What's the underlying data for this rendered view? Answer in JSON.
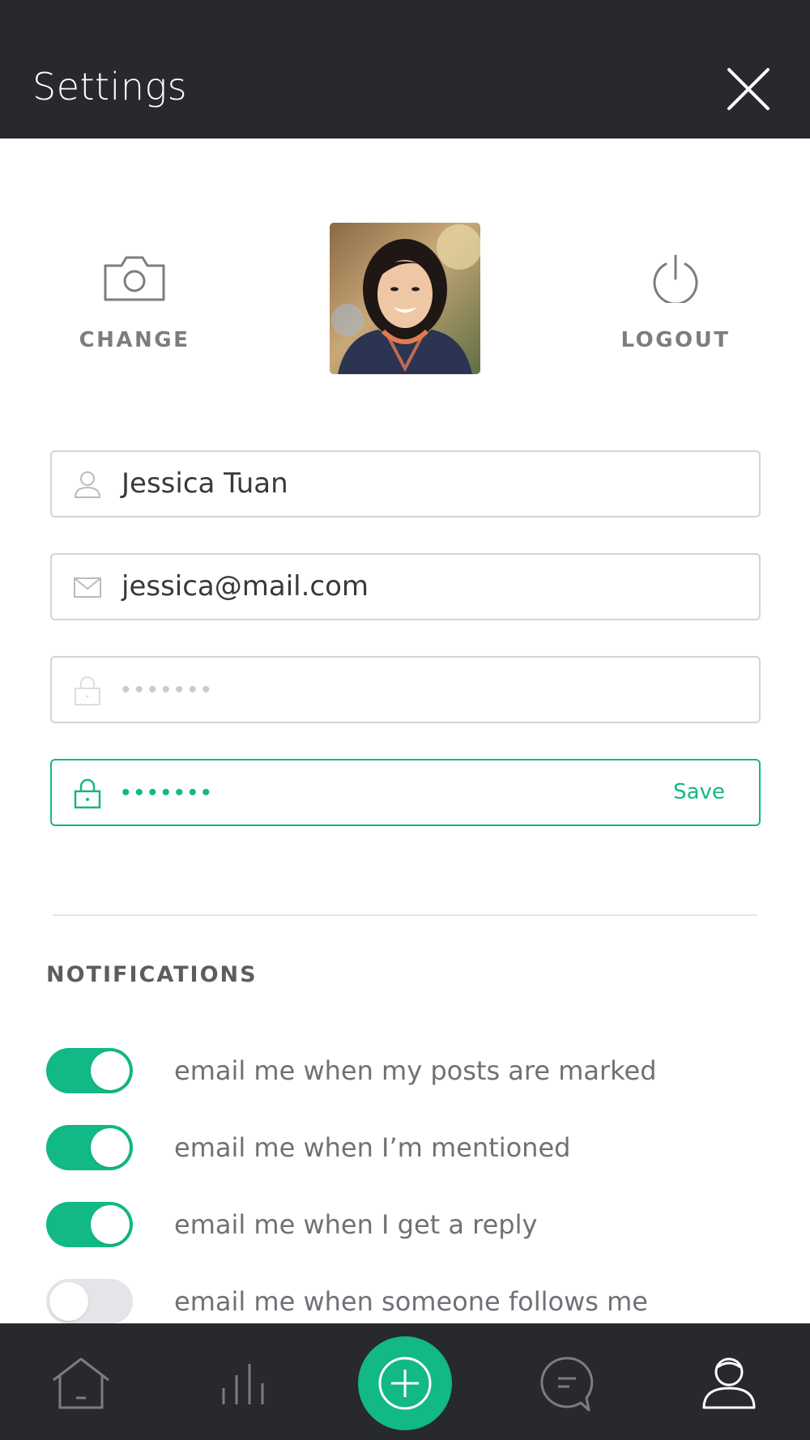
{
  "header": {
    "title": "Settings"
  },
  "profile": {
    "change_label": "CHANGE",
    "logout_label": "LOGOUT"
  },
  "form": {
    "name_value": "Jessica Tuan",
    "email_value": "jessica@mail.com",
    "password_dots": "•••••••",
    "new_password_dots": "•••••••",
    "save_label": "Save"
  },
  "notifications": {
    "title": "NOTIFICATIONS",
    "items": [
      {
        "label": "email me when my posts are marked",
        "enabled": true
      },
      {
        "label": "email me when I’m mentioned",
        "enabled": true
      },
      {
        "label": "email me when I get a reply",
        "enabled": true
      },
      {
        "label": "email me when someone follows me",
        "enabled": false
      }
    ]
  },
  "bottom_nav": {
    "items": [
      "home-icon",
      "stats-icon",
      "add-icon",
      "messages-icon",
      "profile-icon"
    ],
    "active": "profile-icon"
  },
  "colors": {
    "accent": "#12b886",
    "header_bg": "#27292c",
    "text_muted": "#7b7d80"
  }
}
